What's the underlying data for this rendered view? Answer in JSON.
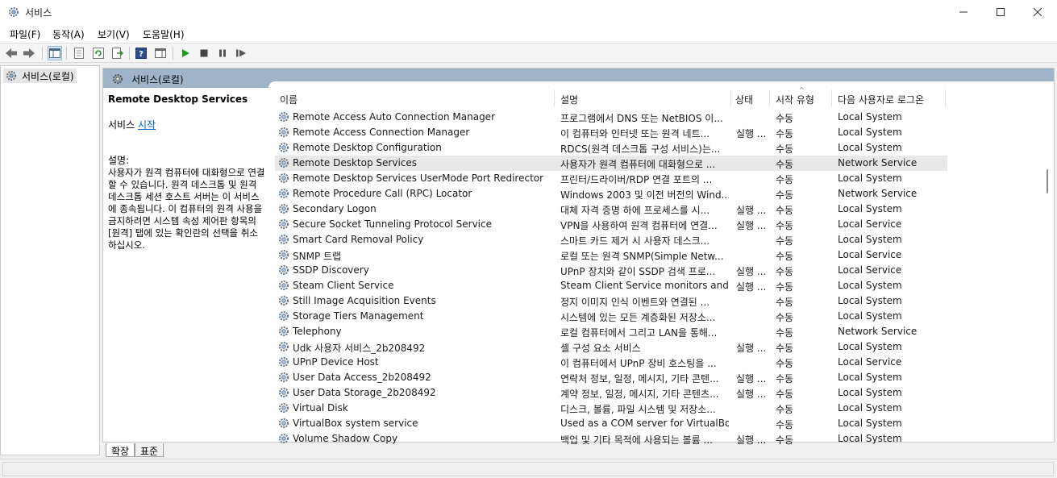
{
  "window": {
    "title": "서비스"
  },
  "menu": [
    "파일(F)",
    "동작(A)",
    "보기(V)",
    "도움말(H)"
  ],
  "toolbar": {
    "icons": [
      "back-arrow-icon",
      "forward-arrow-icon",
      "console-tree-icon",
      "properties-icon",
      "refresh-icon",
      "export-icon",
      "help-icon",
      "view-icon",
      "start-service-icon",
      "stop-service-icon",
      "pause-service-icon",
      "resume-service-icon"
    ]
  },
  "tree": {
    "root_label": "서비스(로컬)"
  },
  "pane": {
    "header_title": "서비스(로컬)",
    "selected_service": "Remote Desktop Services",
    "start_prefix": "서비스 ",
    "start_link": "시작",
    "description_label": "설명:",
    "description_text": "사용자가 원격 컴퓨터에 대화형으로 연결할 수 있습니다. 원격 데스크톱 및 원격 데스크톱 세션 호스트 서버는 이 서비스에 종속됩니다. 이 컴퓨터의 원격 사용을 금지하려면 시스템 속성 제어판 항목의 [원격] 탭에 있는 확인란의 선택을 취소하십시오."
  },
  "table": {
    "columns": [
      "이름",
      "설명",
      "상태",
      "시작 유형",
      "다음 사용자로 로그온"
    ],
    "rows": [
      [
        "Remote Access Auto Connection Manager",
        "프로그램에서 DNS 또는 NetBIOS 이...",
        "",
        "수동",
        "Local System"
      ],
      [
        "Remote Access Connection Manager",
        "이 컴퓨터와 인터넷 또는 원격 네트...",
        "실행 ...",
        "수동",
        "Local System"
      ],
      [
        "Remote Desktop Configuration",
        "RDCS(원격 데스크톱 구성 서비스)는...",
        "",
        "수동",
        "Local System"
      ],
      [
        "Remote Desktop Services",
        "사용자가 원격 컴퓨터에 대화형으로 ...",
        "",
        "수동",
        "Network Service"
      ],
      [
        "Remote Desktop Services UserMode Port Redirector",
        "프린터/드라이버/RDP 연결 포트의 ...",
        "",
        "수동",
        "Local System"
      ],
      [
        "Remote Procedure Call (RPC) Locator",
        "Windows 2003 및 이전 버전의 Wind...",
        "",
        "수동",
        "Network Service"
      ],
      [
        "Secondary Logon",
        "대체 자격 증명 하에 프로세스를 시...",
        "실행 ...",
        "수동",
        "Local System"
      ],
      [
        "Secure Socket Tunneling Protocol Service",
        "VPN을 사용하여 원격 컴퓨터에 연결...",
        "실행 ...",
        "수동",
        "Local Service"
      ],
      [
        "Smart Card Removal Policy",
        "스마트 카드 제거 시 사용자 데스크...",
        "",
        "수동",
        "Local System"
      ],
      [
        "SNMP 트랩",
        "로컬 또는 원격 SNMP(Simple Netw...",
        "",
        "수동",
        "Local Service"
      ],
      [
        "SSDP Discovery",
        "UPnP 장치와 같이 SSDP 검색 프로...",
        "실행 ...",
        "수동",
        "Local Service"
      ],
      [
        "Steam Client Service",
        "Steam Client Service monitors and ...",
        "실행 ...",
        "수동",
        "Local System"
      ],
      [
        "Still Image Acquisition Events",
        "정지 이미지 인식 이벤트와 연결된 ...",
        "",
        "수동",
        "Local System"
      ],
      [
        "Storage Tiers Management",
        "시스템에 있는 모든 계층화된 저장소...",
        "",
        "수동",
        "Local System"
      ],
      [
        "Telephony",
        "로컬 컴퓨터에서 그리고 LAN을 통해...",
        "",
        "수동",
        "Network Service"
      ],
      [
        "Udk 사용자 서비스_2b208492",
        "셸 구성 요소 서비스",
        "실행 ...",
        "수동",
        "Local System"
      ],
      [
        "UPnP Device Host",
        "이 컴퓨터에서 UPnP 장비 호스팅을 ...",
        "",
        "수동",
        "Local Service"
      ],
      [
        "User Data Access_2b208492",
        "연락처 정보, 일정, 메시지, 기타 콘텐...",
        "실행 ...",
        "수동",
        "Local System"
      ],
      [
        "User Data Storage_2b208492",
        "계약 정보, 일정, 메시지, 기타 콘텐츠...",
        "실행 ...",
        "수동",
        "Local System"
      ],
      [
        "Virtual Disk",
        "디스크, 볼륨, 파일 시스템 및 저장소...",
        "",
        "수동",
        "Local System"
      ],
      [
        "VirtualBox system service",
        "Used as a COM server for VirtualBox...",
        "",
        "수동",
        "Local System"
      ],
      [
        "Volume Shadow Copy",
        "백업 및 기타 목적에 사용되는 볼륨 ...",
        "실행 ...",
        "수동",
        "Local System"
      ]
    ]
  },
  "tabs": [
    "확장",
    "표준"
  ]
}
